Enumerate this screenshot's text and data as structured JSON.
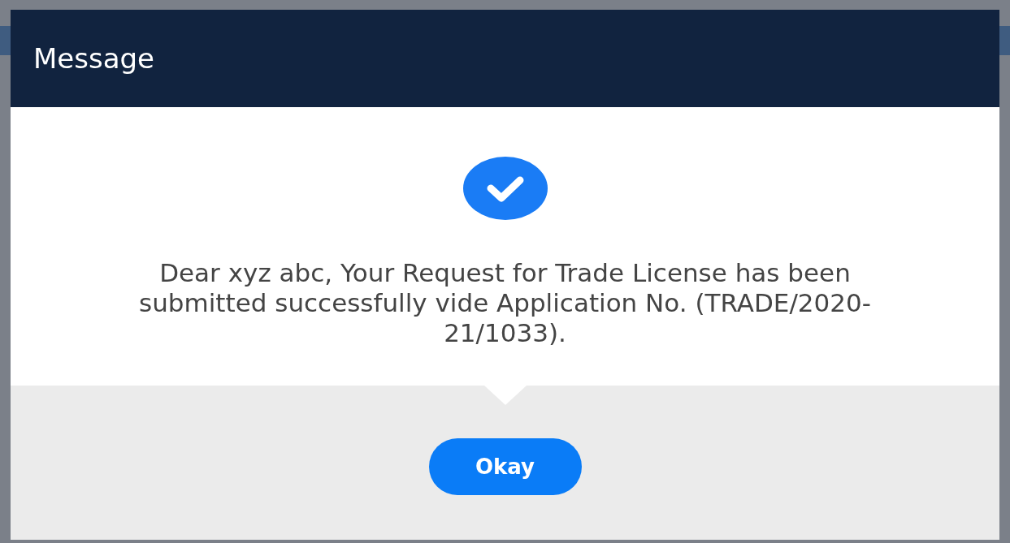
{
  "dialog": {
    "title": "Message",
    "message": "Dear xyz abc, Your Request for Trade License has been submitted successfully vide Application No. (TRADE/2020-21/1033).",
    "button": "Okay"
  }
}
